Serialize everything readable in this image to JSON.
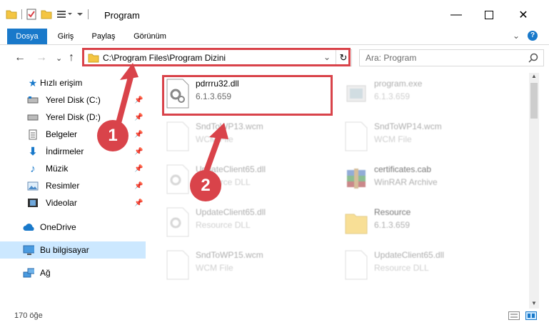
{
  "window": {
    "title": "Program"
  },
  "ribbon": {
    "tabs": [
      {
        "label": "Dosya",
        "active": true
      },
      {
        "label": "Giriş"
      },
      {
        "label": "Paylaş"
      },
      {
        "label": "Görünüm"
      }
    ]
  },
  "address": {
    "path": "C:\\Program Files\\Program Dizini"
  },
  "search": {
    "placeholder": "Ara: Program"
  },
  "sidebar": {
    "items": [
      {
        "label": "Hızlı erişim",
        "icon": "star-icon"
      },
      {
        "label": "Yerel Disk (C:)",
        "icon": "drive-icon",
        "pinned": true
      },
      {
        "label": "Yerel Disk (D:)",
        "icon": "drive-icon",
        "pinned": true
      },
      {
        "label": "Belgeler",
        "icon": "documents-icon",
        "pinned": true
      },
      {
        "label": "İndirmeler",
        "icon": "download-icon",
        "pinned": true
      },
      {
        "label": "Müzik",
        "icon": "music-icon",
        "pinned": true
      },
      {
        "label": "Resimler",
        "icon": "pictures-icon",
        "pinned": true
      },
      {
        "label": "Videolar",
        "icon": "videos-icon",
        "pinned": true
      },
      {
        "label": "OneDrive",
        "icon": "cloud-icon"
      },
      {
        "label": "Bu bilgisayar",
        "icon": "computer-icon",
        "selected": true
      },
      {
        "label": "Ağ",
        "icon": "network-icon"
      }
    ]
  },
  "files": [
    {
      "name": "pdrrru32.dll",
      "meta": "6.1.3.659",
      "icon": "dll-gear-icon"
    },
    {
      "name": "program.exe",
      "meta": "6.1.3.659",
      "icon": "exe-icon"
    },
    {
      "name": "SndToWP13.wcm",
      "meta": "WCM File",
      "icon": "blank-file-icon"
    },
    {
      "name": "SndToWP14.wcm",
      "meta": "WCM File",
      "icon": "blank-file-icon"
    },
    {
      "name": "UpdateClient65.dll",
      "meta": "Resource DLL",
      "icon": "dll-gear-icon"
    },
    {
      "name": "certificates.cab",
      "meta": "WinRAR Archive",
      "icon": "winrar-icon"
    },
    {
      "name": "UpdateClient65.dll",
      "meta": "Resource DLL",
      "icon": "dll-gear-icon"
    },
    {
      "name": "Resource",
      "meta": "6.1.3.659",
      "icon": "folder-icon"
    },
    {
      "name": "SndToWP15.wcm",
      "meta": "WCM File",
      "icon": "blank-file-icon"
    },
    {
      "name": "UpdateClient65.dll",
      "meta": "Resource DLL",
      "icon": "blank-file-icon"
    }
  ],
  "status": {
    "item_count": "170 öğe"
  },
  "callouts": [
    "1",
    "2"
  ],
  "colors": {
    "accent": "#1979ca",
    "highlight": "#d9434a",
    "selected": "#cce8ff"
  }
}
